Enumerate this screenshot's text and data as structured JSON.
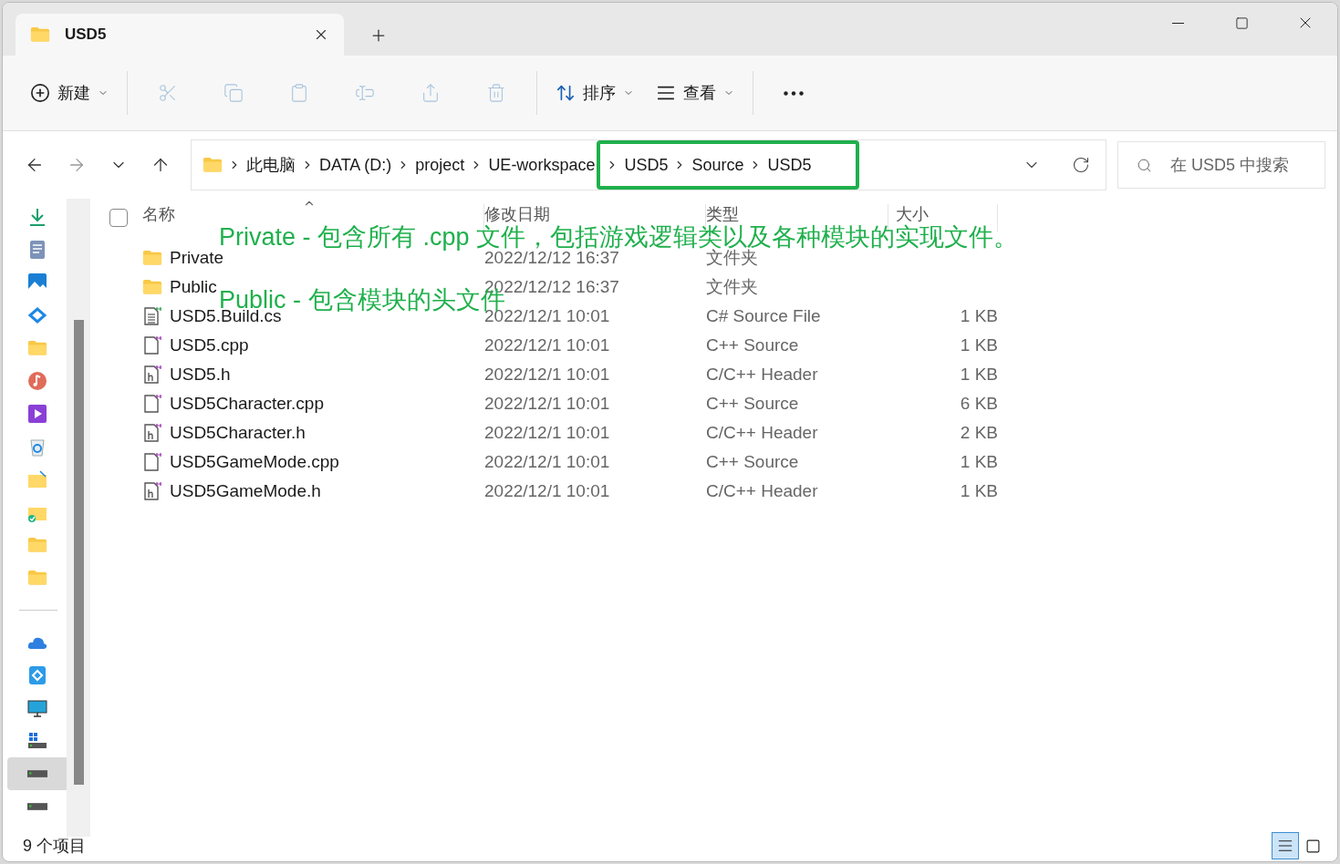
{
  "window": {
    "tab_title": "USD5"
  },
  "toolbar": [
    {
      "kind": "new",
      "label": "新建",
      "disabled": false
    },
    {
      "kind": "cut",
      "disabled": true
    },
    {
      "kind": "copy",
      "disabled": true
    },
    {
      "kind": "paste",
      "disabled": true
    },
    {
      "kind": "rename",
      "disabled": true
    },
    {
      "kind": "share",
      "disabled": true
    },
    {
      "kind": "delete",
      "disabled": true
    },
    {
      "kind": "sort",
      "label": "排序",
      "disabled": false
    },
    {
      "kind": "view",
      "label": "查看",
      "disabled": false
    },
    {
      "kind": "more",
      "disabled": false
    }
  ],
  "address": {
    "crumbs": [
      {
        "label": "此电脑",
        "highlighted": false
      },
      {
        "label": "DATA (D:)",
        "highlighted": false
      },
      {
        "label": "project",
        "highlighted": false
      },
      {
        "label": "UE-workspace",
        "highlighted": false
      },
      {
        "label": "USD5",
        "highlighted": true
      },
      {
        "label": "Source",
        "highlighted": true
      },
      {
        "label": "USD5",
        "highlighted": true
      }
    ]
  },
  "search": {
    "placeholder": "在 USD5 中搜索"
  },
  "sidebar": {
    "pinned": [
      {
        "kind": "download",
        "selected": false
      },
      {
        "kind": "document",
        "selected": false
      },
      {
        "kind": "picture",
        "selected": false
      },
      {
        "kind": "app",
        "selected": false
      },
      {
        "kind": "folder",
        "selected": false
      },
      {
        "kind": "music",
        "selected": false
      },
      {
        "kind": "video",
        "selected": false
      },
      {
        "kind": "recycle",
        "selected": false
      },
      {
        "kind": "folder-pin",
        "selected": false
      },
      {
        "kind": "folder-synced",
        "selected": false
      },
      {
        "kind": "folder",
        "selected": false
      },
      {
        "kind": "folder",
        "selected": false
      }
    ],
    "locations": [
      {
        "kind": "cloud",
        "selected": false
      },
      {
        "kind": "drive-app",
        "selected": false
      },
      {
        "kind": "pc",
        "selected": false
      },
      {
        "kind": "windows-drive",
        "selected": false
      },
      {
        "kind": "drive",
        "selected": true
      },
      {
        "kind": "drive",
        "selected": false
      }
    ]
  },
  "table": {
    "select_all": {
      "checked": false
    },
    "columns": [
      "名称",
      "修改日期",
      "类型",
      "大小"
    ],
    "rows": [
      {
        "kind": "folder",
        "name": "Private",
        "modified": "2022/12/12 16:37",
        "type": "文件夹"
      },
      {
        "kind": "folder",
        "name": "Public",
        "modified": "2022/12/12 16:37",
        "type": "文件夹"
      },
      {
        "kind": "cs",
        "name": "USD5.Build.cs",
        "modified": "2022/12/1 10:01",
        "type": "C# Source File",
        "size": "1 KB"
      },
      {
        "kind": "cpp",
        "name": "USD5.cpp",
        "modified": "2022/12/1 10:01",
        "type": "C++ Source",
        "size": "1 KB"
      },
      {
        "kind": "h",
        "name": "USD5.h",
        "modified": "2022/12/1 10:01",
        "type": "C/C++ Header",
        "size": "1 KB"
      },
      {
        "kind": "cpp",
        "name": "USD5Character.cpp",
        "modified": "2022/12/1 10:01",
        "type": "C++ Source",
        "size": "6 KB"
      },
      {
        "kind": "h",
        "name": "USD5Character.h",
        "modified": "2022/12/1 10:01",
        "type": "C/C++ Header",
        "size": "2 KB"
      },
      {
        "kind": "cpp",
        "name": "USD5GameMode.cpp",
        "modified": "2022/12/1 10:01",
        "type": "C++ Source",
        "size": "1 KB"
      },
      {
        "kind": "h",
        "name": "USD5GameMode.h",
        "modified": "2022/12/1 10:01",
        "type": "C/C++ Header",
        "size": "1 KB"
      }
    ]
  },
  "annotations": [
    {
      "text": "Private - 包含所有 .cpp 文件，包括游戏逻辑类以及各种模块的实现文件。"
    },
    {
      "text": "Public - 包含模块的头文件"
    }
  ],
  "status_bar": {
    "count": "9 个项目"
  },
  "view_buttons": [
    {
      "kind": "details",
      "selected": true
    },
    {
      "kind": "tiles",
      "selected": false
    }
  ]
}
